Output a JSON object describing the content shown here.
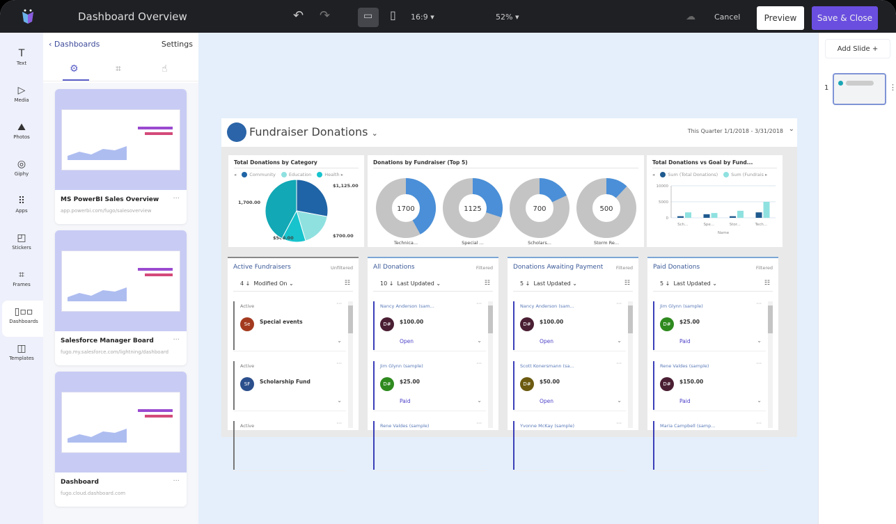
{
  "topbar": {
    "title": "Dashboard Overview",
    "aspect": "16:9 ▾",
    "zoom": "52% ▾",
    "cancel": "Cancel",
    "preview": "Preview",
    "save": "Save & Close"
  },
  "rail": [
    {
      "label": "Text",
      "icon": "T"
    },
    {
      "label": "Media",
      "icon": "▷"
    },
    {
      "label": "Photos",
      "icon": "⛰"
    },
    {
      "label": "Giphy",
      "icon": "◎"
    },
    {
      "label": "Apps",
      "icon": "⠿"
    },
    {
      "label": "Stickers",
      "icon": "◰"
    },
    {
      "label": "Frames",
      "icon": "⌗"
    },
    {
      "label": "Dashboards",
      "icon": "▯▫▫"
    },
    {
      "label": "Templates",
      "icon": "◫"
    }
  ],
  "panel": {
    "back": "Dashboards",
    "settings": "Settings",
    "cards": [
      {
        "name": "MS PowerBI Sales Overview",
        "url": "app.powerbi.com/fugo/salesoverview"
      },
      {
        "name": "Salesforce Manager Board",
        "url": "fugo.my.salesforce.com/lightning/dashboard"
      },
      {
        "name": "Dashboard",
        "url": "fugo.cloud.dashboard.com"
      }
    ]
  },
  "right": {
    "add_slide": "Add Slide +",
    "slide_number": "1"
  },
  "dashboard": {
    "title": "Fundraiser Donations",
    "date_range": "This Quarter 1/1/2018 - 3/31/2018",
    "lists": [
      {
        "title": "Active Fundraisers",
        "filter": "Unfiltered",
        "count": "4",
        "sort": "Modified On",
        "items": [
          {
            "head": "Active",
            "initials": "Se",
            "color": "#a33a1f",
            "value": "Special events",
            "status": ""
          },
          {
            "head": "Active",
            "initials": "SF",
            "color": "#2b4f8c",
            "value": "Scholarship Fund",
            "status": ""
          },
          {
            "head": "Active"
          }
        ]
      },
      {
        "title": "All Donations",
        "filter": "Filtered",
        "count": "10",
        "sort": "Last Updated",
        "items": [
          {
            "head": "Nancy Anderson (sam...",
            "initials": "D#",
            "color": "#4a1e33",
            "value": "$100.00",
            "status": "Open"
          },
          {
            "head": "Jim Glynn (sample)",
            "initials": "D#",
            "color": "#2e8a1e",
            "value": "$25.00",
            "status": "Paid"
          },
          {
            "head": "Rene Valdes (sample)"
          }
        ]
      },
      {
        "title": "Donations Awaiting Payment",
        "filter": "Filtered",
        "count": "5",
        "sort": "Last Updated",
        "items": [
          {
            "head": "Nancy Anderson (sam...",
            "initials": "D#",
            "color": "#4a1e33",
            "value": "$100.00",
            "status": "Open"
          },
          {
            "head": "Scott Konersmann (sa...",
            "initials": "D#",
            "color": "#6b5a10",
            "value": "$50.00",
            "status": "Open"
          },
          {
            "head": "Yvonne McKay (sample)"
          }
        ]
      },
      {
        "title": "Paid Donations",
        "filter": "Filtered",
        "count": "5",
        "sort": "Last Updated",
        "items": [
          {
            "head": "Jim Glynn (sample)",
            "initials": "D#",
            "color": "#2e8a1e",
            "value": "$25.00",
            "status": "Paid"
          },
          {
            "head": "Rene Valdes (sample)",
            "initials": "D#",
            "color": "#4a1e33",
            "value": "$150.00",
            "status": "Paid"
          },
          {
            "head": "Maria Campbell (samp..."
          }
        ]
      }
    ]
  },
  "chart_data": [
    {
      "type": "pie",
      "title": "Total Donations by Category",
      "legend": [
        "Community",
        "Education",
        "Health"
      ],
      "slices": [
        {
          "label": "$1,125.00",
          "value": 1125,
          "color": "#1f64a6"
        },
        {
          "label": "$700.00",
          "value": 700,
          "color": "#8fe1e0"
        },
        {
          "label": "$500.00",
          "value": 500,
          "color": "#17c3cc"
        },
        {
          "label": "1,700.00",
          "value": 1700,
          "color": "#12a8b5"
        }
      ]
    },
    {
      "type": "donut",
      "title": "Donations by Fundraiser (Top 5)",
      "items": [
        {
          "label": "Technica...",
          "value": 1700,
          "fraction": 0.42
        },
        {
          "label": "Special ...",
          "value": 1125,
          "fraction": 0.3
        },
        {
          "label": "Scholars...",
          "value": 700,
          "fraction": 0.18
        },
        {
          "label": "Storm Re...",
          "value": 500,
          "fraction": 0.12
        }
      ]
    },
    {
      "type": "bar",
      "title": "Total Donations vs Goal by Fund...",
      "xlabel": "Name",
      "categories": [
        "Sch...",
        "Spe...",
        "Stor...",
        "Tech..."
      ],
      "ylim": [
        0,
        10000
      ],
      "yticks": [
        0,
        5000,
        10000
      ],
      "series": [
        {
          "name": "Sum (Total Donations)",
          "color": "#1f5a8e",
          "values": [
            500,
            1125,
            500,
            1700
          ]
        },
        {
          "name": "Sum (Fundrais",
          "color": "#8fe1e0",
          "values": [
            1700,
            1500,
            2200,
            5000
          ]
        }
      ]
    }
  ]
}
